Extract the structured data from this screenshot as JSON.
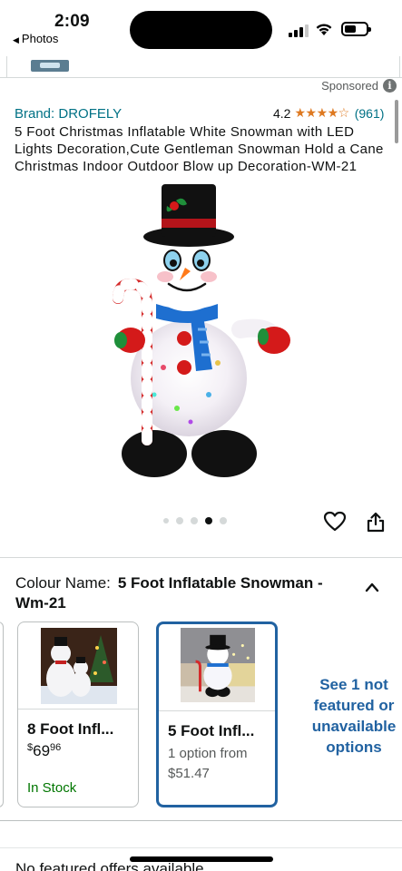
{
  "status_bar": {
    "time": "2:09",
    "back_label": "Photos",
    "back_glyph": "◀"
  },
  "ad": {
    "sponsored_label": "Sponsored",
    "info_glyph": "i"
  },
  "product": {
    "brand": "Brand: DROFELY",
    "rating": "4.2",
    "stars": "★★★★☆",
    "rating_count": "(961)",
    "title": "5 Foot Christmas Inflatable White Snowman with LED Lights Decoration,Cute Gentleman Snowman Hold a Cane Christmas Indoor Outdoor Blow up Decoration-WM-21",
    "image_count": 5,
    "active_image_index": 3
  },
  "variation": {
    "label": "Colour Name:",
    "selected_value": "5 Foot Inflatable Snowman - Wm-21",
    "options": [
      {
        "name": "8 Foot Infl...",
        "price_dollars": "$69",
        "price_cents": "96",
        "stock": "In Stock",
        "selected": false
      },
      {
        "name": "5 Foot Infl...",
        "sub_line1": "1 option from",
        "sub_line2": "$51.47",
        "selected": true
      }
    ],
    "see_more": "See 1 not featured or unavailable options"
  },
  "footer": {
    "no_offers": "No featured offers available"
  },
  "colors": {
    "link": "#007185",
    "star": "#de7921",
    "selected_border": "#2162a1",
    "in_stock": "#007600"
  }
}
